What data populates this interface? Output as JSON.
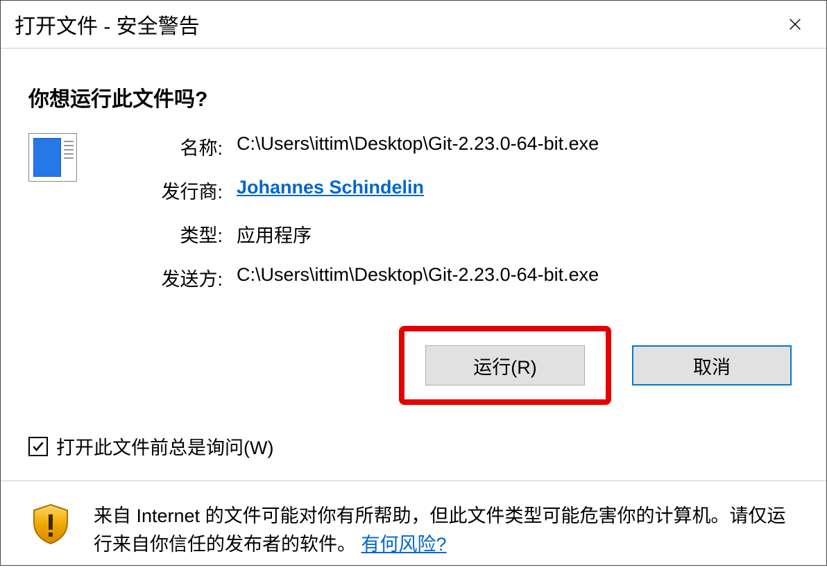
{
  "titlebar": {
    "title": "打开文件 - 安全警告"
  },
  "question": "你想运行此文件吗?",
  "info": {
    "name_label": "名称:",
    "name_value": "C:\\Users\\ittim\\Desktop\\Git-2.23.0-64-bit.exe",
    "publisher_label": "发行商:",
    "publisher_value": "Johannes Schindelin",
    "type_label": "类型:",
    "type_value": "应用程序",
    "from_label": "发送方:",
    "from_value": "C:\\Users\\ittim\\Desktop\\Git-2.23.0-64-bit.exe"
  },
  "buttons": {
    "run": "运行(R)",
    "cancel": "取消"
  },
  "checkbox": {
    "label": "打开此文件前总是询问(W)",
    "checked": true
  },
  "footer": {
    "text_part1": "来自 Internet 的文件可能对你有所帮助，但此文件类型可能危害你的计算机。请仅运行来自你信任的发布者的软件。",
    "link": "有何风险?"
  }
}
